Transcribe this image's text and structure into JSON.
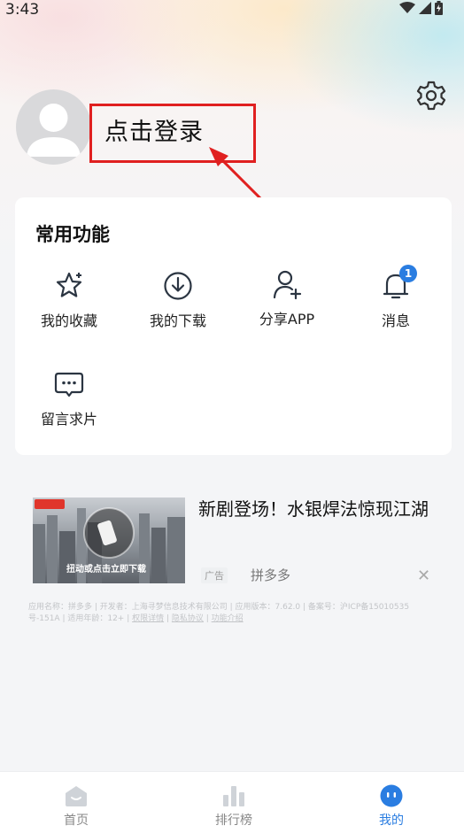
{
  "status_bar": {
    "time": "3:43"
  },
  "profile": {
    "login_text": "点击登录"
  },
  "features": {
    "title": "常用功能",
    "items": [
      {
        "label": "我的收藏",
        "icon": "star-icon"
      },
      {
        "label": "我的下载",
        "icon": "download-icon"
      },
      {
        "label": "分享APP",
        "icon": "share-user-icon"
      },
      {
        "label": "消息",
        "icon": "bell-icon",
        "badge": "1"
      },
      {
        "label": "留言求片",
        "icon": "message-icon"
      }
    ]
  },
  "ad": {
    "title": "新剧登场！水银焊法惊现江湖",
    "thumb_caption": "扭动或点击立即下载",
    "tag": "广告",
    "brand": "拼多多",
    "info_text": "应用名称：拼多多 | 开发者：上海寻梦信息技术有限公司 | 应用版本：7.62.0 | 备案号：沪ICP备15010535号-151A | 适用年龄：12+ | ",
    "links": [
      "权限详情",
      "隐私协议",
      "功能介绍"
    ]
  },
  "tabbar": {
    "items": [
      {
        "label": "首页",
        "active": false
      },
      {
        "label": "排行榜",
        "active": false
      },
      {
        "label": "我的",
        "active": true
      }
    ]
  },
  "colors": {
    "accent": "#2a7de1",
    "annotation": "#e02020"
  }
}
